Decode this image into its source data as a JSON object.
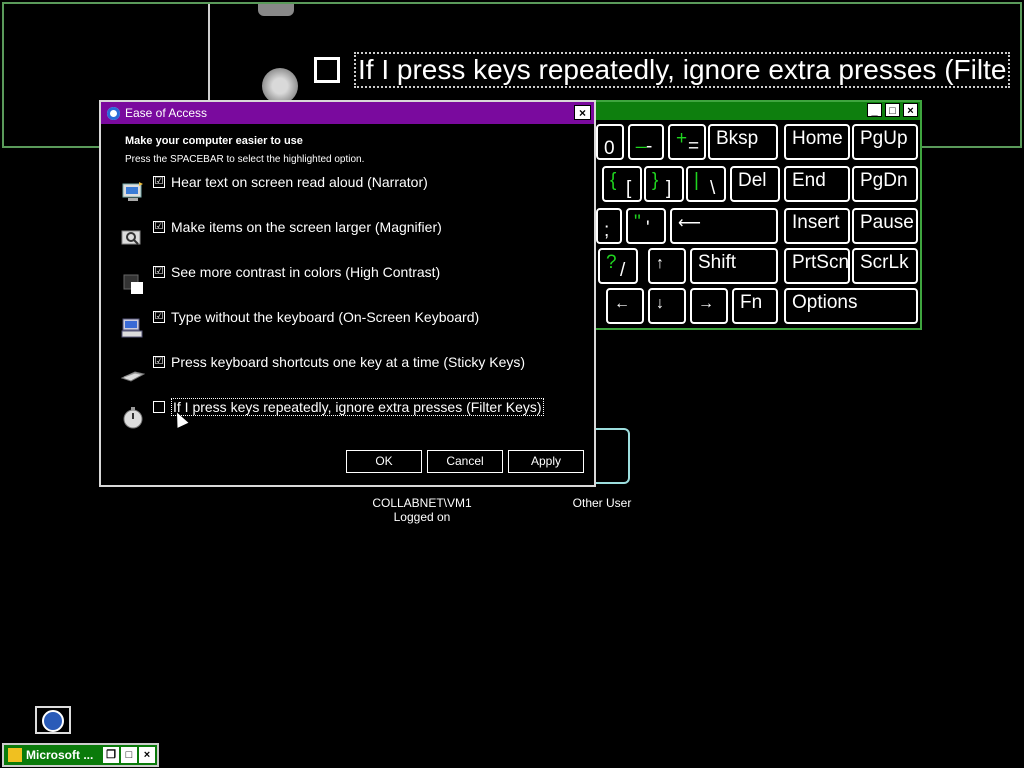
{
  "magnifier": {
    "zoomed_text": "If I press keys repeatedly, ignore extra presses (Filte"
  },
  "osk": {
    "keys": {
      "zero": "0",
      "minus_top": "_",
      "minus_bot": "-",
      "plus_top": "+",
      "plus_bot": "=",
      "bksp": "Bksp",
      "home": "Home",
      "pgup": "PgUp",
      "brace_open_top": "{",
      "brace_open_bot": "[",
      "brace_close_top": "}",
      "brace_close_bot": "]",
      "pipe_top": "|",
      "pipe_bot": "\\",
      "del": "Del",
      "end": "End",
      "pgdn": "PgDn",
      "semicolon": ";",
      "quote_top": "\"",
      "quote_bot": "'",
      "enter": "⟵",
      "insert": "Insert",
      "pause": "Pause",
      "q_top": "?",
      "q_bot": "/",
      "up": "↑",
      "shift": "Shift",
      "prtscn": "PrtScn",
      "scrlk": "ScrLk",
      "left": "←",
      "down": "↓",
      "right": "→",
      "fn": "Fn",
      "options": "Options"
    }
  },
  "logon": {
    "user1_line1": "COLLABNET\\VM1",
    "user1_line2": "Logged on",
    "user2": "Other User"
  },
  "dialog": {
    "title": "Ease of Access",
    "heading": "Make your computer easier to use",
    "subheading": "Press the SPACEBAR to select the highlighted option.",
    "options": [
      {
        "label": "Hear text on screen read aloud (Narrator)",
        "checked": "☑",
        "icon": "narrator-icon"
      },
      {
        "label": "Make items on the screen larger (Magnifier)",
        "checked": "☑",
        "icon": "magnifier-icon"
      },
      {
        "label": "See more contrast in colors (High Contrast)",
        "checked": "☑",
        "icon": "contrast-icon"
      },
      {
        "label": "Type without the keyboard (On-Screen Keyboard)",
        "checked": "☑",
        "icon": "keyboard-icon"
      },
      {
        "label": "Press keyboard shortcuts one key at a time (Sticky Keys)",
        "checked": "☑",
        "icon": "sticky-keys-icon"
      },
      {
        "label": "If I press keys repeatedly, ignore extra presses (Filter Keys)",
        "checked": "",
        "icon": "stopwatch-icon"
      }
    ],
    "ok": "OK",
    "cancel": "Cancel",
    "apply": "Apply"
  },
  "taskbar": {
    "mini_title": "Microsoft ..."
  }
}
